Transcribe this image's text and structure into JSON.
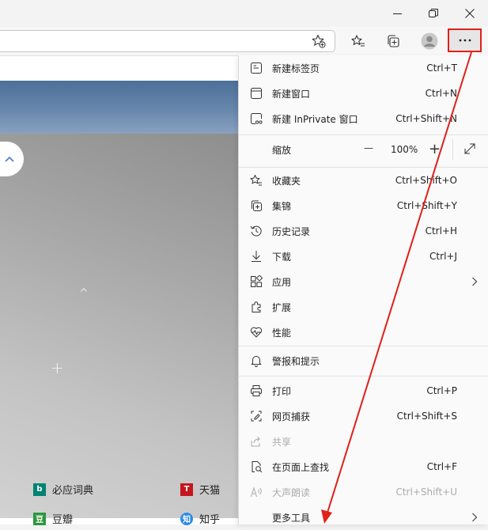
{
  "window": {
    "minimize_icon": "minimize-icon",
    "restore_icon": "restore-icon",
    "close_icon": "close-icon"
  },
  "toolbar": {
    "address_value": "",
    "add_favorite_icon": "star-plus-icon",
    "favorites_icon": "favorites-icon",
    "collections_icon": "collections-icon",
    "profile_icon": "profile-icon",
    "more_icon": "more-icon",
    "highlight_color": "#e0201a"
  },
  "page": {
    "quick_links": [
      {
        "label": "必应词典",
        "icon": "bing-icon",
        "color": "#008373"
      },
      {
        "label": "天猫",
        "icon": "tmall-icon",
        "color": "#c4161c"
      },
      {
        "label": "豆瓣",
        "icon": "douban-icon",
        "color": "#2e963d"
      },
      {
        "label": "知乎",
        "icon": "zhihu-icon",
        "color": "#2e8ae6"
      }
    ]
  },
  "menu": {
    "items": [
      {
        "label": "新建标签页",
        "shortcut": "Ctrl+T"
      },
      {
        "label": "新建窗口",
        "shortcut": "Ctrl+N"
      },
      {
        "label": "新建 InPrivate 窗口",
        "shortcut": "Ctrl+Shift+N"
      },
      {
        "label": "收藏夹",
        "shortcut": "Ctrl+Shift+O"
      },
      {
        "label": "集锦",
        "shortcut": "Ctrl+Shift+Y"
      },
      {
        "label": "历史记录",
        "shortcut": "Ctrl+H"
      },
      {
        "label": "下载",
        "shortcut": "Ctrl+J"
      },
      {
        "label": "应用",
        "shortcut": ""
      },
      {
        "label": "扩展",
        "shortcut": ""
      },
      {
        "label": "性能",
        "shortcut": ""
      },
      {
        "label": "警报和提示",
        "shortcut": ""
      },
      {
        "label": "打印",
        "shortcut": "Ctrl+P"
      },
      {
        "label": "网页捕获",
        "shortcut": "Ctrl+Shift+S"
      },
      {
        "label": "共享",
        "shortcut": ""
      },
      {
        "label": "在页面上查找",
        "shortcut": "Ctrl+F"
      },
      {
        "label": "大声朗读",
        "shortcut": "Ctrl+Shift+U"
      },
      {
        "label": "更多工具",
        "shortcut": ""
      }
    ],
    "zoom": {
      "label": "缩放",
      "value": "100%",
      "minus": "—",
      "plus": "+"
    },
    "annotation_color": "#e0201a"
  }
}
